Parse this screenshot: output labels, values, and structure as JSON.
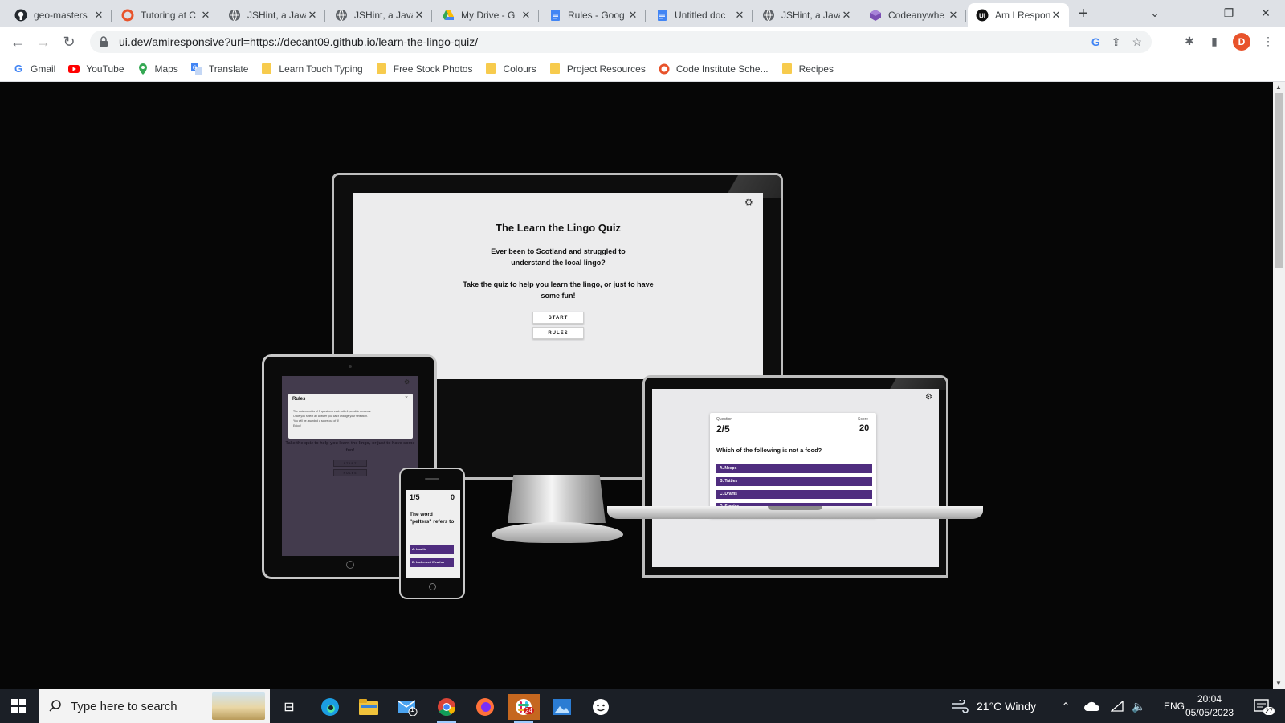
{
  "browser": {
    "tabs": [
      {
        "title": "geo-masters",
        "icon": "github-icon"
      },
      {
        "title": "Tutoring at C",
        "icon": "code-institute-icon"
      },
      {
        "title": "JSHint, a Java",
        "icon": "globe-icon"
      },
      {
        "title": "JSHint, a Java",
        "icon": "globe-icon"
      },
      {
        "title": "My Drive - G",
        "icon": "google-drive-icon"
      },
      {
        "title": "Rules - Goog",
        "icon": "google-docs-icon"
      },
      {
        "title": "Untitled doc",
        "icon": "google-docs-icon"
      },
      {
        "title": "JSHint, a Java",
        "icon": "globe-icon"
      },
      {
        "title": "Codeanywhe",
        "icon": "codeanywhere-icon"
      },
      {
        "title": "Am I Respon",
        "icon": "ui-dev-icon",
        "active": true
      }
    ],
    "url": "ui.dev/amiresponsive?url=https://decant09.github.io/learn-the-lingo-quiz/",
    "profile_initial": "D",
    "bookmarks": [
      {
        "label": "Gmail",
        "icon": "google-icon"
      },
      {
        "label": "YouTube",
        "icon": "youtube-icon"
      },
      {
        "label": "Maps",
        "icon": "maps-icon"
      },
      {
        "label": "Translate",
        "icon": "translate-icon"
      },
      {
        "label": "Learn Touch Typing",
        "icon": "folder-icon"
      },
      {
        "label": "Free Stock Photos",
        "icon": "folder-icon"
      },
      {
        "label": "Colours",
        "icon": "folder-icon"
      },
      {
        "label": "Project Resources",
        "icon": "folder-icon"
      },
      {
        "label": "Code Institute Sche...",
        "icon": "code-institute-icon"
      },
      {
        "label": "Recipes",
        "icon": "folder-icon"
      }
    ]
  },
  "desktop_site": {
    "title": "The Learn the Lingo Quiz",
    "intro_1": "Ever been to Scotland and struggled to understand the local lingo?",
    "intro_2": "Take the quiz to help you learn the lingo, or just to have some fun!",
    "start_label": "START",
    "rules_label": "RULES"
  },
  "tablet_site": {
    "modal_title": "Rules",
    "close": "×",
    "rules": [
      "The quiz consists of 5 questions each with 4 possible answers.",
      "Once you select an answer you can't change your selection.",
      "You will be awarded a score out of 5!",
      "Enjoy!"
    ],
    "intro": "Take the quiz to help you learn the lingo, or just to have some fun!",
    "start_label": "START",
    "rules_label": "RULES"
  },
  "phone_site": {
    "question_no": "1/5",
    "score": "0",
    "question": "The word \"pelters\" refers to",
    "answers": [
      "A. Insults",
      "B. Inclement Weather"
    ]
  },
  "laptop_site": {
    "question_label": "Question",
    "question_no": "2/5",
    "score_label": "Score",
    "score": "20",
    "question": "Which of the following is not a food?",
    "answers": [
      "A. Neeps",
      "B. Tatties",
      "C. Drams",
      "D. Stovies"
    ]
  },
  "colors": {
    "answer_purple": "#4f2d7f",
    "page_bg": "#060606",
    "profile": "#e8532b"
  },
  "taskbar": {
    "search_placeholder": "Type here to search",
    "apps": [
      "task-view-icon",
      "edge-icon",
      "file-explorer-icon",
      "mail-icon",
      "chrome-icon",
      "firefox-icon",
      "slack-icon",
      "photos-icon",
      "emoji-app-icon"
    ],
    "mail_badge": "1",
    "slack_badge": "24",
    "weather": "21°C  Windy",
    "language": "ENG",
    "time": "20:04",
    "date": "05/05/2023",
    "notifications": "27"
  }
}
